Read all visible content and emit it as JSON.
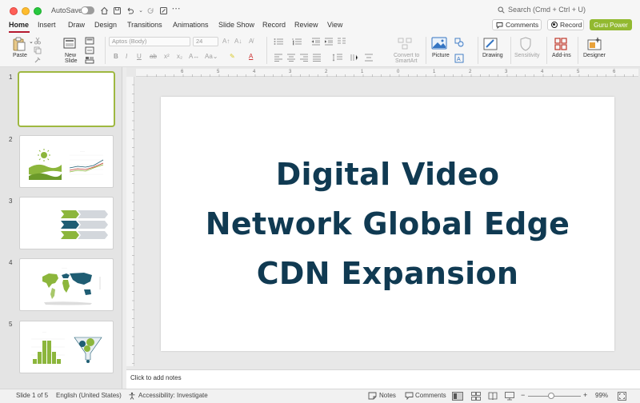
{
  "titlebar": {
    "autosave_label": "AutoSave",
    "search_placeholder": "Search (Cmd + Ctrl + U)"
  },
  "tabs": [
    "Home",
    "Insert",
    "Draw",
    "Design",
    "Transitions",
    "Animations",
    "Slide Show",
    "Record",
    "Review",
    "View"
  ],
  "active_tab": "Home",
  "header_buttons": {
    "comments": "Comments",
    "record": "Record",
    "guru": "Guru Power"
  },
  "ribbon": {
    "paste": "Paste",
    "new_slide_line1": "New",
    "new_slide_line2": "Slide",
    "font_name": "Aptos (Body)",
    "font_size": "24",
    "convert_line1": "Convert to",
    "convert_line2": "SmartArt",
    "picture": "Picture",
    "drawing": "Drawing",
    "sensitivity": "Sensitivity",
    "addins": "Add-ins",
    "designer": "Designer"
  },
  "thumbnails": [
    {
      "number": "1"
    },
    {
      "number": "2"
    },
    {
      "number": "3"
    },
    {
      "number": "4"
    },
    {
      "number": "5"
    }
  ],
  "ruler_numbers": [
    "6",
    "5",
    "4",
    "3",
    "2",
    "1",
    "0",
    "1",
    "2",
    "3",
    "4",
    "5",
    "6"
  ],
  "slide": {
    "title_lines": [
      "Digital Video",
      "Network Global Edge",
      "CDN Expansion"
    ]
  },
  "notes_placeholder": "Click to add notes",
  "status": {
    "slide_counter": "Slide 1 of 5",
    "language": "English (United States)",
    "accessibility": "Accessibility: Investigate",
    "notes": "Notes",
    "comments": "Comments",
    "zoom": "99%"
  },
  "colors": {
    "title_text": "#103a52",
    "accent_green": "#92b930",
    "tab_underline": "#b5192f"
  }
}
